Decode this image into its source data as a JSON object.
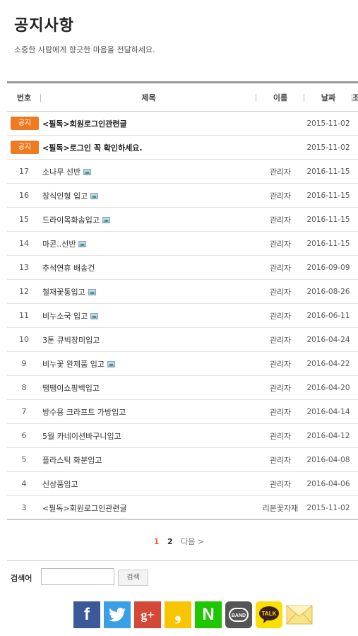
{
  "header": {
    "title": "공지사항",
    "subtitle": "소중한 사람에게 향긋한 마음을 전달하세요."
  },
  "table": {
    "columns": {
      "num": "번호",
      "title": "제목",
      "name": "이름",
      "date": "날짜",
      "extra": "조"
    },
    "notices": [
      {
        "badge": "공지",
        "title": "<필독>회원로그인관련글",
        "name": "",
        "date": "2015-11-02"
      },
      {
        "badge": "공지",
        "title": "<필독>로그인 꼭 확인하세요.",
        "name": "",
        "date": "2015-11-02"
      }
    ],
    "rows": [
      {
        "num": "17",
        "title": "소나무 선반",
        "name": "관리자",
        "date": "2016-11-15",
        "has_image": true
      },
      {
        "num": "16",
        "title": "장식인형 입고",
        "name": "관리자",
        "date": "2016-11-15",
        "has_image": true
      },
      {
        "num": "15",
        "title": "드라이목화솜입고",
        "name": "관리자",
        "date": "2016-11-15",
        "has_image": true
      },
      {
        "num": "14",
        "title": "마콘..선반",
        "name": "관리자",
        "date": "2016-11-15",
        "has_image": true
      },
      {
        "num": "13",
        "title": "추석연휴 배송건",
        "name": "관리자",
        "date": "2016-09-09",
        "has_image": false
      },
      {
        "num": "12",
        "title": "철재꽃통입고",
        "name": "관리자",
        "date": "2016-08-26",
        "has_image": true
      },
      {
        "num": "11",
        "title": "비누소국 입고",
        "name": "관리자",
        "date": "2016-06-11",
        "has_image": true
      },
      {
        "num": "10",
        "title": "3톤 큐빅장미입고",
        "name": "관리자",
        "date": "2016-04-24",
        "has_image": false
      },
      {
        "num": "9",
        "title": "비누꽃 완제품 입고",
        "name": "관리자",
        "date": "2016-04-22",
        "has_image": true
      },
      {
        "num": "8",
        "title": "땡땡이쇼핑백입고",
        "name": "관리자",
        "date": "2016-04-20",
        "has_image": false
      },
      {
        "num": "7",
        "title": "방수용 크라프트 가방입고",
        "name": "관리자",
        "date": "2016-04-14",
        "has_image": false
      },
      {
        "num": "6",
        "title": "5월 카네이션바구니입고",
        "name": "관리자",
        "date": "2016-04-12",
        "has_image": false
      },
      {
        "num": "5",
        "title": "플라스틱 화분입고",
        "name": "관리자",
        "date": "2016-04-08",
        "has_image": false
      },
      {
        "num": "4",
        "title": "신상품입고",
        "name": "관리자",
        "date": "2016-04-06",
        "has_image": false
      },
      {
        "num": "3",
        "title": "<필독>회원로그인관련글",
        "name": "리본꽃자재",
        "date": "2015-11-02",
        "has_image": false
      }
    ]
  },
  "pagination": {
    "current": "1",
    "page2": "2",
    "next": "다음 >"
  },
  "search": {
    "label": "검색어",
    "button": "검색",
    "value": ""
  },
  "share": {
    "facebook": "f",
    "googleplus": "g+",
    "kakaostory": "❟",
    "naver": "N",
    "band": "BAND",
    "talk": "TALK"
  },
  "colors": {
    "notice_badge": "#ee7b22",
    "current_page": "#e46a1d"
  }
}
